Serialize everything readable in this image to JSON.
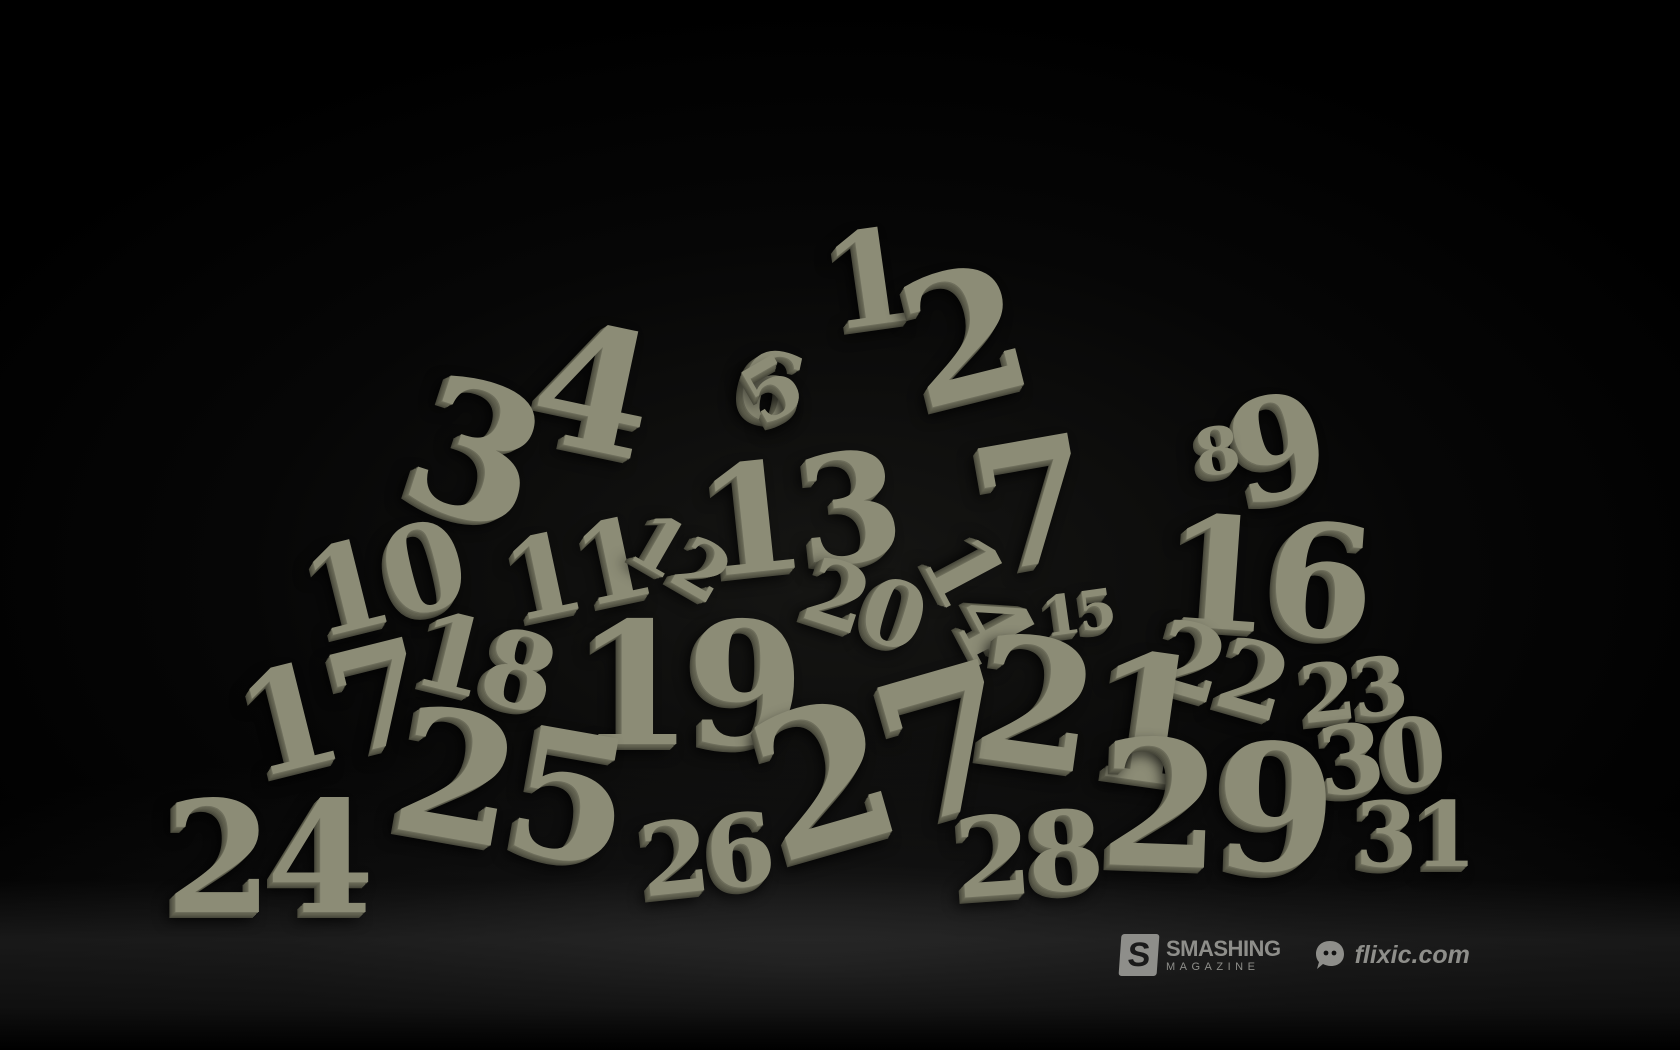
{
  "wallpaper": {
    "numbers": [
      "1",
      "2",
      "3",
      "4",
      "5",
      "6",
      "7",
      "8",
      "9",
      "10",
      "11",
      "12",
      "13",
      "14",
      "15",
      "16",
      "17",
      "18",
      "19",
      "20",
      "21",
      "22",
      "23",
      "24",
      "25",
      "26",
      "27",
      "28",
      "29",
      "30",
      "31"
    ],
    "colors": {
      "digit_face": "#8c8c76",
      "background": "#000000",
      "logo": "#8e8e8a"
    }
  },
  "branding": {
    "smashing_badge": "S",
    "smashing_title": "SMASHING",
    "smashing_subtitle": "MAGAZINE",
    "flixic_text": "flixic.com",
    "flixic_icon": "speech-bubble-icon"
  }
}
